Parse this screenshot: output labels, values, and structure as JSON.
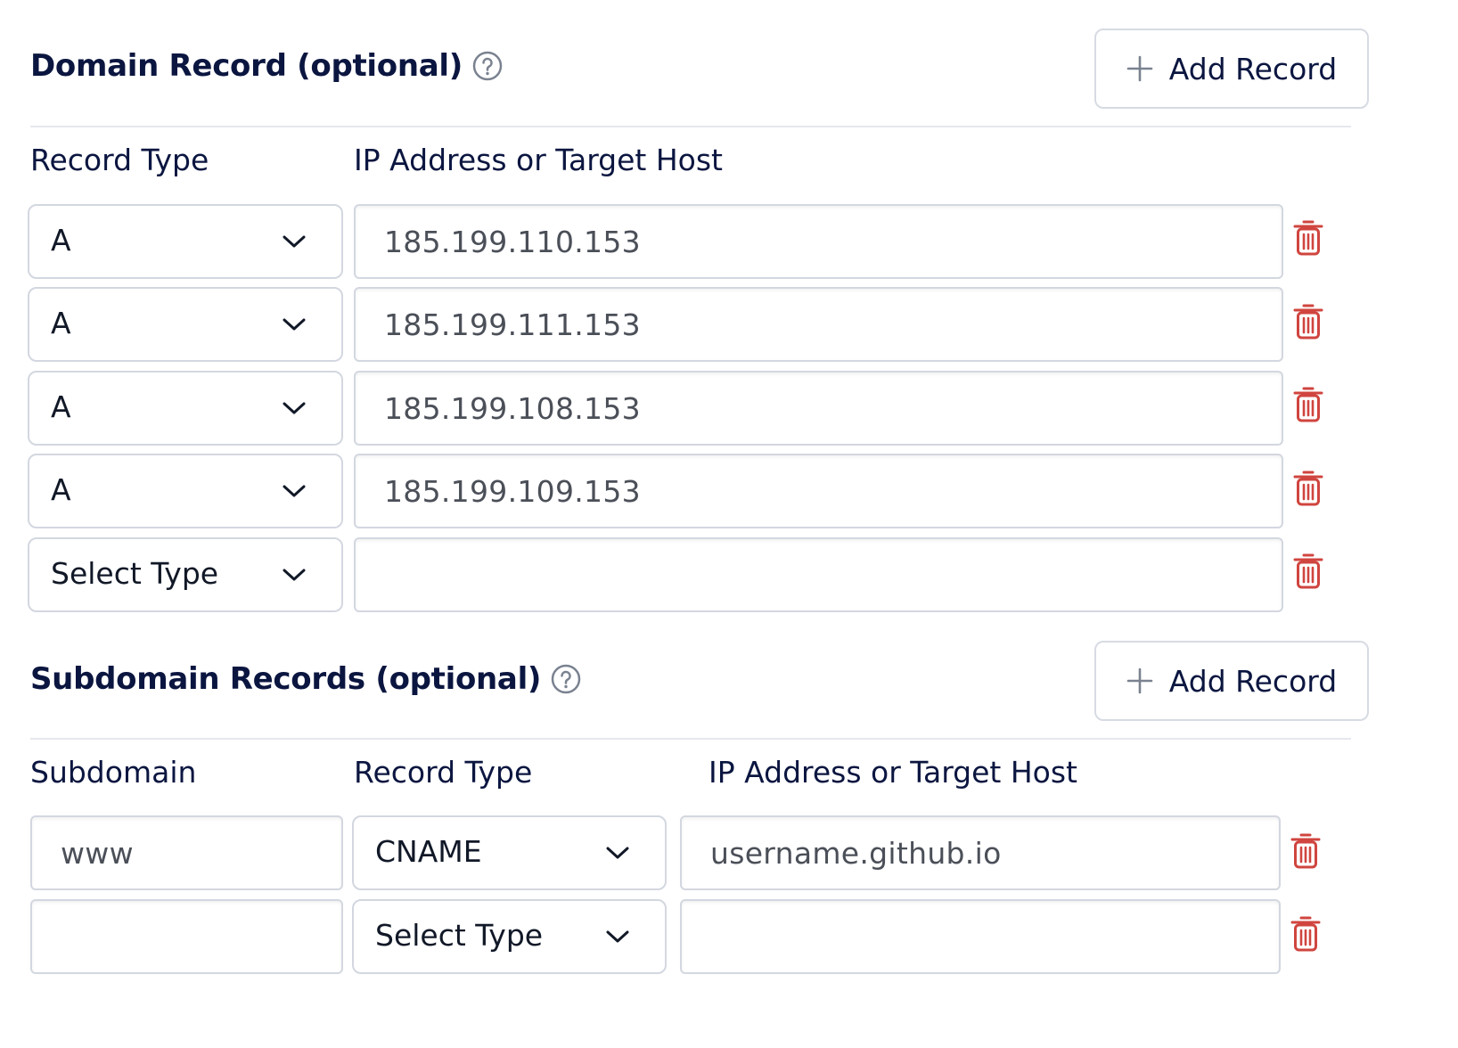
{
  "domain_section": {
    "title": "Domain Record (optional)",
    "help_icon": "help-circle-icon",
    "add_button_label": "Add Record",
    "columns": {
      "record_type": "Record Type",
      "target": "IP Address or Target Host"
    },
    "rows": [
      {
        "type": "A",
        "target": "185.199.110.153"
      },
      {
        "type": "A",
        "target": "185.199.111.153"
      },
      {
        "type": "A",
        "target": "185.199.108.153"
      },
      {
        "type": "A",
        "target": "185.199.109.153"
      },
      {
        "type": "Select Type",
        "target": ""
      }
    ]
  },
  "subdomain_section": {
    "title": "Subdomain Records (optional)",
    "help_icon": "help-circle-icon",
    "add_button_label": "Add Record",
    "columns": {
      "subdomain": "Subdomain",
      "record_type": "Record Type",
      "target": "IP Address or Target Host"
    },
    "rows": [
      {
        "subdomain": "www",
        "type": "CNAME",
        "target": "username.github.io"
      },
      {
        "subdomain": "",
        "type": "Select Type",
        "target": ""
      }
    ]
  },
  "colors": {
    "heading": "#0b1640",
    "border": "#d3d7e0",
    "delete_icon": "#d0453f",
    "muted_icon": "#7a8290"
  },
  "icons": {
    "add": "plus-icon",
    "dropdown": "chevron-down-icon",
    "delete": "trash-icon"
  }
}
